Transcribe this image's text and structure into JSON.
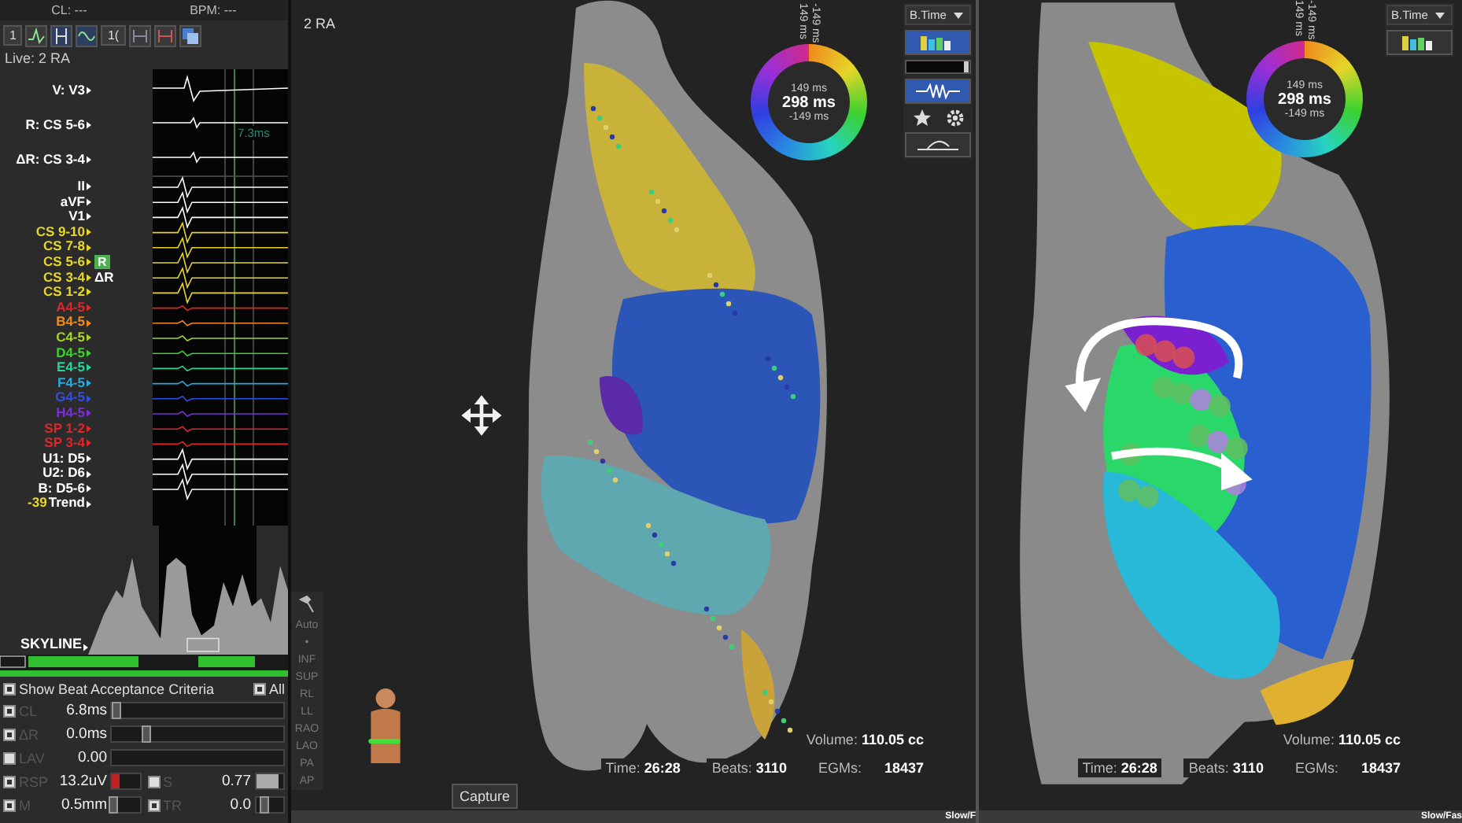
{
  "header": {
    "cl": "CL: ---",
    "bpm": "BPM: ---"
  },
  "toolbar": {
    "channel_select": "1",
    "page_select": "1("
  },
  "live_label": "Live: 2 RA",
  "reference_channels": [
    {
      "label": "V: V3",
      "color": "#ffffff"
    },
    {
      "label": "R: CS 5-6",
      "color": "#ffffff"
    },
    {
      "label": "ΔR: CS 3-4",
      "color": "#ffffff"
    }
  ],
  "measurement": "7.3ms",
  "channels": [
    {
      "label": "II",
      "color": "#ffffff"
    },
    {
      "label": "aVF",
      "color": "#ffffff"
    },
    {
      "label": "V1",
      "color": "#ffffff"
    },
    {
      "label": "CS 9-10",
      "color": "#e6d62a"
    },
    {
      "label": "CS 7-8",
      "color": "#e6d62a"
    },
    {
      "label": "CS 5-6",
      "color": "#e6d62a",
      "marker": {
        "kind": "badge",
        "text": "R"
      }
    },
    {
      "label": "CS 3-4",
      "color": "#e6d62a",
      "marker": {
        "kind": "plain",
        "text": "ΔR"
      }
    },
    {
      "label": "CS 1-2",
      "color": "#e6d62a"
    },
    {
      "label": "A4-5",
      "color": "#e0262a"
    },
    {
      "label": "B4-5",
      "color": "#f08a1c"
    },
    {
      "label": "C4-5",
      "color": "#a6d42a"
    },
    {
      "label": "D4-5",
      "color": "#3bd12f"
    },
    {
      "label": "E4-5",
      "color": "#26d49a"
    },
    {
      "label": "F4-5",
      "color": "#2aa8e0"
    },
    {
      "label": "G4-5",
      "color": "#2f4fe0"
    },
    {
      "label": "H4-5",
      "color": "#7b2fd6"
    },
    {
      "label": "SP 1-2",
      "color": "#e0262a"
    },
    {
      "label": "SP 3-4",
      "color": "#e0262a"
    },
    {
      "label": "U1: D5",
      "color": "#ffffff"
    },
    {
      "label": "U2: D6",
      "color": "#ffffff"
    },
    {
      "label": "B: D5-6",
      "color": "#ffffff"
    }
  ],
  "trend": {
    "value": "-39",
    "label": "Trend"
  },
  "skyline_label": "SKYLINE",
  "criteria": {
    "title": "Show Beat Acceptance Criteria",
    "checked": true,
    "all": {
      "label": "All",
      "checked": true
    },
    "rows": [
      [
        {
          "label": "CL",
          "value": "6.8ms",
          "checked": true,
          "kind": "thumb",
          "level": 0.03
        }
      ],
      [
        {
          "label": "ΔR",
          "value": "0.0ms",
          "checked": true,
          "kind": "thumb",
          "level": 0.2
        }
      ],
      [
        {
          "label": "LAV",
          "value": "0.00",
          "checked": false,
          "kind": "track"
        }
      ],
      [
        {
          "label": "RSP",
          "value": "13.2uV",
          "checked": true,
          "kind": "alert",
          "level": 0.3
        },
        {
          "label": "S",
          "value": "0.77",
          "checked": false,
          "kind": "fill",
          "level": 0.8
        }
      ],
      [
        {
          "label": "M",
          "value": "0.5mm",
          "checked": true,
          "kind": "thumb",
          "level": 0.05
        },
        {
          "label": "TR",
          "value": "0.0",
          "checked": true,
          "kind": "thumb",
          "level": 0.3
        }
      ]
    ]
  },
  "center_view": {
    "title": "2 RA",
    "color_scale": {
      "top_labels": [
        "149 ms",
        "-149 ms"
      ],
      "upper": "149 ms",
      "center": "298 ms",
      "lower": "-149 ms"
    },
    "mode_select": "B.Time",
    "opacity_slider": {
      "level": 0.95
    },
    "view_buttons": [
      "Auto",
      "•",
      "INF",
      "SUP",
      "RL",
      "LL",
      "RAO",
      "LAO",
      "PA",
      "AP"
    ],
    "capture": "Capture",
    "stats": [
      {
        "label": "Volume:",
        "value": "110.05 cc"
      },
      {
        "label": "Time:",
        "value": "26:28"
      },
      {
        "label": "Beats:",
        "value": "3110"
      },
      {
        "label": "EGMs:",
        "value": "18437"
      }
    ],
    "footer": "Slow/F"
  },
  "right_view": {
    "color_scale": {
      "top_labels": [
        "149 ms",
        "-149 ms"
      ],
      "upper": "149 ms",
      "center": "298 ms",
      "lower": "-149 ms"
    },
    "mode_select": "B.Time",
    "stats": [
      {
        "label": "Volume:",
        "value": "110.05 cc"
      },
      {
        "label": "Time:",
        "value": "26:28"
      },
      {
        "label": "Beats:",
        "value": "3110"
      },
      {
        "label": "EGMs:",
        "value": "18437"
      }
    ],
    "footer": "Slow/Fas"
  }
}
